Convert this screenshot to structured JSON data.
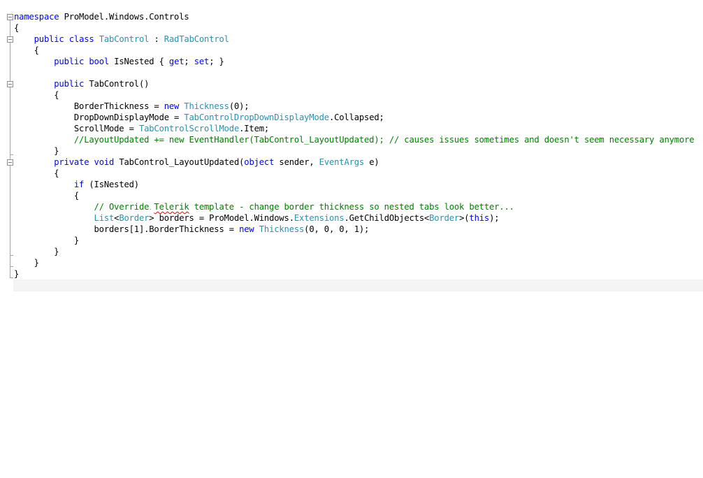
{
  "colors": {
    "keyword": "#0000ff",
    "type": "#2b91af",
    "comment": "#008000",
    "text": "#000000",
    "squiggle": "#ff0000",
    "background": "#ffffff"
  },
  "lines": [
    [
      {
        "t": "kw",
        "v": "namespace"
      },
      {
        "t": "tx",
        "v": " ProModel.Windows.Controls"
      }
    ],
    [
      {
        "t": "tx",
        "v": "{"
      }
    ],
    [
      {
        "t": "tx",
        "v": "    "
      },
      {
        "t": "kw",
        "v": "public"
      },
      {
        "t": "tx",
        "v": " "
      },
      {
        "t": "kw",
        "v": "class"
      },
      {
        "t": "tx",
        "v": " "
      },
      {
        "t": "ty",
        "v": "TabControl"
      },
      {
        "t": "tx",
        "v": " : "
      },
      {
        "t": "ty",
        "v": "RadTabControl"
      }
    ],
    [
      {
        "t": "tx",
        "v": "    {"
      }
    ],
    [
      {
        "t": "tx",
        "v": "        "
      },
      {
        "t": "kw",
        "v": "public"
      },
      {
        "t": "tx",
        "v": " "
      },
      {
        "t": "kw",
        "v": "bool"
      },
      {
        "t": "tx",
        "v": " IsNested { "
      },
      {
        "t": "kw",
        "v": "get"
      },
      {
        "t": "tx",
        "v": "; "
      },
      {
        "t": "kw",
        "v": "set"
      },
      {
        "t": "tx",
        "v": "; }"
      }
    ],
    [
      {
        "t": "tx",
        "v": ""
      }
    ],
    [
      {
        "t": "tx",
        "v": "        "
      },
      {
        "t": "kw",
        "v": "public"
      },
      {
        "t": "tx",
        "v": " TabControl()"
      }
    ],
    [
      {
        "t": "tx",
        "v": "        {"
      }
    ],
    [
      {
        "t": "tx",
        "v": "            BorderThickness = "
      },
      {
        "t": "kw",
        "v": "new"
      },
      {
        "t": "tx",
        "v": " "
      },
      {
        "t": "ty",
        "v": "Thickness"
      },
      {
        "t": "tx",
        "v": "(0);"
      }
    ],
    [
      {
        "t": "tx",
        "v": "            DropDownDisplayMode = "
      },
      {
        "t": "ty",
        "v": "TabControlDropDownDisplayMode"
      },
      {
        "t": "tx",
        "v": ".Collapsed;"
      }
    ],
    [
      {
        "t": "tx",
        "v": "            ScrollMode = "
      },
      {
        "t": "ty",
        "v": "TabControlScrollMode"
      },
      {
        "t": "tx",
        "v": ".Item;"
      }
    ],
    [
      {
        "t": "tx",
        "v": "            "
      },
      {
        "t": "cm",
        "v": "//LayoutUpdated += new EventHandler(TabControl_LayoutUpdated); // causes issues sometimes and doesn't seem necessary anymore"
      }
    ],
    [
      {
        "t": "tx",
        "v": "        }"
      }
    ],
    [
      {
        "t": "tx",
        "v": "        "
      },
      {
        "t": "kw",
        "v": "private"
      },
      {
        "t": "tx",
        "v": " "
      },
      {
        "t": "kw",
        "v": "void"
      },
      {
        "t": "tx",
        "v": " TabControl_LayoutUpdated("
      },
      {
        "t": "kw",
        "v": "object"
      },
      {
        "t": "tx",
        "v": " sender, "
      },
      {
        "t": "ty",
        "v": "EventArgs"
      },
      {
        "t": "tx",
        "v": " e)"
      }
    ],
    [
      {
        "t": "tx",
        "v": "        {"
      }
    ],
    [
      {
        "t": "tx",
        "v": "            "
      },
      {
        "t": "kw",
        "v": "if"
      },
      {
        "t": "tx",
        "v": " (IsNested)"
      }
    ],
    [
      {
        "t": "tx",
        "v": "            {"
      }
    ],
    [
      {
        "t": "tx",
        "v": "                "
      },
      {
        "t": "cm",
        "v": "// Override "
      },
      {
        "t": "cmsq",
        "v": "Telerik"
      },
      {
        "t": "cm",
        "v": " template - change border thickness so nested tabs look better..."
      }
    ],
    [
      {
        "t": "tx",
        "v": "                "
      },
      {
        "t": "ty",
        "v": "List"
      },
      {
        "t": "tx",
        "v": "<"
      },
      {
        "t": "ty",
        "v": "Border"
      },
      {
        "t": "tx",
        "v": "> borders = ProModel.Windows."
      },
      {
        "t": "ty",
        "v": "Extensions"
      },
      {
        "t": "tx",
        "v": ".GetChildObjects<"
      },
      {
        "t": "ty",
        "v": "Border"
      },
      {
        "t": "tx",
        "v": ">("
      },
      {
        "t": "kw",
        "v": "this"
      },
      {
        "t": "tx",
        "v": ");"
      }
    ],
    [
      {
        "t": "tx",
        "v": "                borders[1].BorderThickness = "
      },
      {
        "t": "kw",
        "v": "new"
      },
      {
        "t": "tx",
        "v": " "
      },
      {
        "t": "ty",
        "v": "Thickness"
      },
      {
        "t": "tx",
        "v": "(0, 0, 0, 1);"
      }
    ],
    [
      {
        "t": "tx",
        "v": "            }"
      }
    ],
    [
      {
        "t": "tx",
        "v": "        }"
      }
    ],
    [
      {
        "t": "tx",
        "v": "    }"
      }
    ],
    [
      {
        "t": "tx",
        "v": "}"
      }
    ]
  ]
}
